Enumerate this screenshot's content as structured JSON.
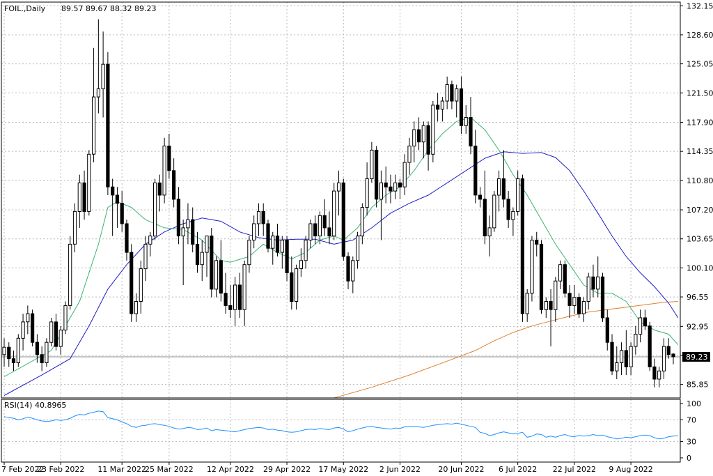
{
  "header": {
    "symbol_label": "FOIL.,Daily",
    "ohlc_label": "89.57 89.67 88.32 89.23"
  },
  "price_badge": "89.23",
  "indicator": {
    "label": "RSI(14) 40.8965",
    "levels": [
      "100",
      "70",
      "30",
      "0"
    ]
  },
  "colors": {
    "bull_candle": "#ffffff",
    "bear_candle": "#000000",
    "ma_fast": "#3cb371",
    "ma_mid": "#1e1ec8",
    "ma_slow": "#e08030",
    "rsi_line": "#1e90ff",
    "badge_bg": "#000000",
    "badge_text": "#ffffff"
  },
  "chart_data": {
    "type": "candlestick",
    "y_ticks": [
      "132.15",
      "128.60",
      "125.05",
      "121.50",
      "117.90",
      "114.35",
      "110.80",
      "107.20",
      "103.65",
      "100.10",
      "96.55",
      "92.95",
      "89.40",
      "85.85"
    ],
    "ylim": [
      84.2,
      132.6
    ],
    "x_ticks": [
      "7 Feb 2022",
      "23 Feb 2022",
      "11 Mar 2022",
      "25 Mar 2022",
      "12 Apr 2022",
      "29 Apr 2022",
      "17 May 2022",
      "2 Jun 2022",
      "20 Jun 2022",
      "6 Jul 2022",
      "22 Jul 2022",
      "9 Aug 2022"
    ],
    "candles": [
      [
        89.5,
        91.5,
        88.0,
        90.4
      ],
      [
        90.4,
        91.0,
        88.0,
        89.0
      ],
      [
        89.0,
        90.0,
        87.5,
        88.5
      ],
      [
        88.5,
        92.0,
        88.0,
        91.5
      ],
      [
        91.5,
        94.5,
        90.0,
        93.5
      ],
      [
        93.5,
        95.5,
        92.0,
        94.5
      ],
      [
        94.5,
        95.0,
        90.5,
        91.0
      ],
      [
        91.0,
        92.0,
        88.5,
        89.5
      ],
      [
        89.5,
        90.5,
        87.5,
        88.5
      ],
      [
        88.5,
        91.5,
        88.0,
        91.0
      ],
      [
        91.0,
        94.0,
        90.5,
        93.5
      ],
      [
        93.5,
        94.5,
        90.0,
        90.5
      ],
      [
        90.5,
        93.0,
        89.5,
        92.5
      ],
      [
        92.5,
        96.0,
        92.0,
        95.5
      ],
      [
        95.5,
        104.0,
        95.0,
        103.0
      ],
      [
        103.0,
        108.0,
        102.0,
        107.0
      ],
      [
        107.0,
        111.5,
        105.0,
        110.5
      ],
      [
        110.5,
        112.0,
        106.0,
        107.0
      ],
      [
        107.0,
        114.5,
        106.5,
        114.0
      ],
      [
        114.0,
        127.0,
        113.0,
        121.0
      ],
      [
        121.0,
        130.5,
        119.0,
        122.0
      ],
      [
        122.0,
        129.0,
        118.5,
        125.0
      ],
      [
        125.0,
        126.5,
        109.0,
        110.0
      ],
      [
        110.0,
        111.0,
        104.0,
        109.0
      ],
      [
        109.0,
        110.0,
        105.0,
        108.0
      ],
      [
        108.0,
        109.5,
        104.5,
        105.5
      ],
      [
        105.5,
        106.0,
        101.0,
        102.0
      ],
      [
        102.0,
        103.0,
        93.5,
        94.5
      ],
      [
        94.5,
        97.0,
        93.5,
        96.0
      ],
      [
        96.0,
        101.0,
        94.5,
        100.0
      ],
      [
        100.0,
        104.0,
        98.5,
        103.0
      ],
      [
        103.0,
        104.5,
        101.5,
        104.0
      ],
      [
        104.0,
        111.0,
        103.5,
        110.5
      ],
      [
        110.5,
        111.5,
        107.0,
        109.0
      ],
      [
        109.0,
        116.0,
        108.0,
        115.0
      ],
      [
        115.0,
        116.5,
        111.0,
        112.0
      ],
      [
        112.0,
        113.5,
        107.5,
        108.5
      ],
      [
        108.5,
        110.0,
        103.0,
        104.0
      ],
      [
        104.0,
        106.0,
        98.0,
        105.0
      ],
      [
        105.0,
        108.0,
        103.0,
        106.0
      ],
      [
        106.0,
        107.5,
        102.0,
        103.0
      ],
      [
        103.0,
        104.5,
        99.5,
        100.5
      ],
      [
        100.5,
        103.5,
        98.5,
        102.0
      ],
      [
        102.0,
        104.0,
        99.0,
        104.0
      ],
      [
        104.0,
        105.0,
        96.5,
        97.5
      ],
      [
        97.5,
        101.5,
        96.5,
        101.0
      ],
      [
        101.0,
        103.5,
        96.0,
        97.0
      ],
      [
        97.0,
        99.5,
        94.5,
        95.5
      ],
      [
        95.5,
        98.0,
        94.0,
        95.0
      ],
      [
        95.0,
        99.0,
        93.0,
        98.0
      ],
      [
        98.0,
        99.5,
        94.0,
        95.0
      ],
      [
        95.0,
        101.0,
        93.0,
        100.5
      ],
      [
        100.5,
        104.0,
        99.5,
        103.5
      ],
      [
        103.5,
        106.5,
        102.5,
        105.5
      ],
      [
        105.5,
        108.0,
        104.0,
        107.0
      ],
      [
        107.0,
        108.0,
        104.0,
        105.5
      ],
      [
        105.5,
        106.0,
        102.0,
        102.5
      ],
      [
        102.5,
        104.5,
        100.5,
        104.0
      ],
      [
        104.0,
        105.5,
        101.5,
        102.0
      ],
      [
        102.0,
        104.0,
        100.0,
        103.5
      ],
      [
        103.5,
        104.0,
        98.5,
        99.5
      ],
      [
        99.5,
        101.5,
        95.0,
        96.0
      ],
      [
        96.0,
        100.5,
        95.0,
        100.0
      ],
      [
        100.0,
        102.5,
        99.0,
        101.0
      ],
      [
        101.0,
        104.0,
        100.0,
        103.5
      ],
      [
        103.5,
        106.0,
        102.5,
        105.5
      ],
      [
        105.5,
        106.5,
        103.0,
        104.0
      ],
      [
        104.0,
        107.0,
        103.0,
        106.5
      ],
      [
        106.5,
        108.5,
        104.0,
        105.0
      ],
      [
        105.0,
        107.0,
        103.0,
        104.0
      ],
      [
        104.0,
        110.5,
        103.5,
        109.5
      ],
      [
        109.5,
        112.0,
        106.5,
        110.5
      ],
      [
        110.5,
        111.0,
        101.0,
        101.5
      ],
      [
        101.5,
        102.0,
        97.5,
        98.5
      ],
      [
        98.5,
        101.5,
        97.0,
        101.0
      ],
      [
        101.0,
        104.5,
        100.0,
        104.0
      ],
      [
        104.0,
        108.0,
        103.0,
        107.5
      ],
      [
        107.5,
        113.0,
        106.5,
        111.0
      ],
      [
        111.0,
        115.5,
        110.5,
        114.5
      ],
      [
        114.5,
        115.0,
        107.5,
        108.5
      ],
      [
        108.5,
        112.0,
        103.5,
        110.5
      ],
      [
        110.5,
        112.5,
        108.0,
        110.0
      ],
      [
        110.0,
        111.5,
        108.0,
        109.5
      ],
      [
        109.5,
        111.5,
        108.5,
        110.5
      ],
      [
        110.5,
        111.0,
        108.5,
        110.0
      ],
      [
        110.0,
        114.0,
        109.0,
        113.0
      ],
      [
        113.0,
        116.0,
        111.5,
        115.0
      ],
      [
        115.0,
        118.0,
        113.0,
        117.0
      ],
      [
        117.0,
        118.5,
        114.5,
        115.5
      ],
      [
        115.5,
        118.0,
        113.5,
        117.5
      ],
      [
        117.5,
        118.0,
        112.0,
        114.0
      ],
      [
        114.0,
        120.5,
        113.0,
        120.0
      ],
      [
        120.0,
        121.5,
        118.0,
        119.5
      ],
      [
        119.5,
        121.0,
        118.0,
        120.5
      ],
      [
        120.5,
        123.5,
        119.5,
        122.5
      ],
      [
        122.5,
        123.0,
        119.5,
        120.5
      ],
      [
        120.5,
        122.5,
        118.5,
        122.0
      ],
      [
        122.0,
        123.5,
        116.5,
        117.5
      ],
      [
        117.5,
        120.0,
        116.5,
        118.5
      ],
      [
        118.5,
        121.0,
        114.0,
        115.0
      ],
      [
        115.0,
        117.0,
        108.0,
        109.0
      ],
      [
        109.0,
        110.0,
        107.5,
        108.5
      ],
      [
        108.5,
        112.0,
        103.0,
        104.0
      ],
      [
        104.0,
        106.5,
        101.5,
        105.0
      ],
      [
        105.0,
        109.5,
        104.5,
        109.0
      ],
      [
        109.0,
        112.0,
        107.0,
        111.0
      ],
      [
        111.0,
        114.5,
        107.5,
        108.5
      ],
      [
        108.5,
        109.5,
        105.0,
        106.0
      ],
      [
        106.0,
        107.5,
        104.0,
        107.0
      ],
      [
        107.0,
        112.0,
        106.5,
        111.0
      ],
      [
        111.0,
        111.5,
        93.5,
        94.5
      ],
      [
        94.5,
        97.5,
        93.5,
        97.0
      ],
      [
        97.0,
        104.0,
        96.0,
        103.5
      ],
      [
        103.5,
        104.5,
        101.5,
        103.0
      ],
      [
        103.0,
        103.5,
        94.5,
        95.0
      ],
      [
        95.0,
        96.5,
        94.0,
        96.0
      ],
      [
        96.0,
        97.5,
        90.5,
        95.0
      ],
      [
        95.0,
        99.0,
        93.5,
        98.5
      ],
      [
        98.5,
        101.0,
        97.5,
        100.5
      ],
      [
        100.5,
        101.0,
        96.5,
        97.0
      ],
      [
        97.0,
        98.0,
        94.0,
        95.5
      ],
      [
        95.5,
        98.0,
        94.5,
        96.5
      ],
      [
        96.5,
        97.0,
        94.0,
        94.5
      ],
      [
        94.5,
        96.5,
        93.5,
        96.0
      ],
      [
        96.0,
        99.5,
        95.0,
        99.0
      ],
      [
        99.0,
        100.5,
        96.5,
        97.5
      ],
      [
        97.5,
        101.5,
        96.5,
        99.0
      ],
      [
        99.0,
        99.5,
        93.5,
        94.0
      ],
      [
        94.0,
        95.0,
        90.0,
        91.0
      ],
      [
        91.0,
        92.0,
        87.0,
        87.5
      ],
      [
        87.5,
        90.5,
        86.5,
        88.5
      ],
      [
        88.5,
        91.0,
        87.0,
        90.0
      ],
      [
        90.0,
        92.5,
        87.0,
        88.0
      ],
      [
        88.0,
        91.0,
        87.0,
        90.5
      ],
      [
        90.5,
        93.0,
        89.5,
        92.0
      ],
      [
        92.0,
        95.0,
        91.0,
        94.0
      ],
      [
        94.0,
        95.0,
        92.5,
        93.0
      ],
      [
        93.0,
        93.5,
        87.5,
        88.0
      ],
      [
        88.0,
        89.0,
        85.5,
        86.5
      ],
      [
        86.5,
        88.0,
        85.5,
        87.5
      ],
      [
        87.5,
        91.5,
        86.5,
        90.5
      ],
      [
        90.5,
        91.5,
        89.0,
        89.5
      ],
      [
        89.57,
        89.67,
        88.32,
        89.23
      ]
    ],
    "rsi": [
      76,
      74,
      73,
      70,
      72,
      75,
      73,
      70,
      68,
      67,
      68,
      70,
      69,
      70,
      73,
      77,
      80,
      79,
      82,
      84,
      86,
      85,
      74,
      72,
      70,
      66,
      63,
      58,
      56,
      59,
      60,
      62,
      63,
      61,
      60,
      58,
      55,
      53,
      54,
      56,
      55,
      52,
      53,
      55,
      50,
      52,
      51,
      50,
      49,
      48,
      50,
      52,
      54,
      55,
      56,
      55,
      52,
      53,
      51,
      50,
      48,
      47,
      48,
      50,
      52,
      53,
      52,
      54,
      53,
      52,
      55,
      56,
      53,
      48,
      50,
      53,
      55,
      57,
      58,
      56,
      55,
      54,
      53,
      55,
      54,
      57,
      58,
      58,
      57,
      56,
      58,
      60,
      61,
      62,
      63,
      62,
      64,
      62,
      60,
      58,
      56,
      47,
      45,
      41,
      43,
      46,
      48,
      46,
      44,
      45,
      47,
      38,
      40,
      44,
      43,
      38,
      40,
      38,
      41,
      43,
      40,
      39,
      41,
      40,
      41,
      43,
      41,
      42,
      39,
      37,
      35,
      36,
      38,
      37,
      39,
      41,
      42,
      41,
      37,
      35,
      36,
      39,
      40,
      40.9
    ],
    "ma_fast": [
      [
        0,
        86.8
      ],
      [
        10,
        90.0
      ],
      [
        16,
        96.0
      ],
      [
        20,
        103.0
      ],
      [
        22,
        107.5
      ],
      [
        24,
        108.2
      ],
      [
        27,
        107.5
      ],
      [
        30,
        106.0
      ],
      [
        34,
        105.0
      ],
      [
        38,
        104.8
      ],
      [
        42,
        103.5
      ],
      [
        46,
        101.0
      ],
      [
        48,
        100.8
      ],
      [
        52,
        101.5
      ],
      [
        55,
        103.0
      ],
      [
        58,
        102.0
      ],
      [
        61,
        101.2
      ],
      [
        64,
        102.0
      ],
      [
        67,
        103.5
      ],
      [
        70,
        104.0
      ],
      [
        72,
        103.5
      ],
      [
        75,
        105.0
      ],
      [
        78,
        107.5
      ],
      [
        81,
        109.0
      ],
      [
        84,
        110.0
      ],
      [
        87,
        112.0
      ],
      [
        90,
        114.5
      ],
      [
        93,
        116.5
      ],
      [
        96,
        118.0
      ],
      [
        99,
        118.5
      ],
      [
        102,
        117.0
      ],
      [
        105,
        114.5
      ],
      [
        108,
        111.5
      ],
      [
        111,
        109.0
      ],
      [
        114,
        106.0
      ],
      [
        117,
        103.0
      ],
      [
        120,
        100.5
      ],
      [
        123,
        98.0
      ],
      [
        126,
        97.0
      ],
      [
        129,
        97.0
      ],
      [
        132,
        96.0
      ],
      [
        135,
        93.5
      ],
      [
        138,
        92.5
      ],
      [
        141,
        92.0
      ],
      [
        143,
        90.7
      ]
    ],
    "ma_mid": [
      [
        0,
        84.5
      ],
      [
        8,
        87.0
      ],
      [
        14,
        89.0
      ],
      [
        18,
        93.0
      ],
      [
        22,
        97.5
      ],
      [
        26,
        100.5
      ],
      [
        30,
        103.0
      ],
      [
        34,
        104.5
      ],
      [
        38,
        105.5
      ],
      [
        42,
        106.2
      ],
      [
        46,
        105.8
      ],
      [
        50,
        104.5
      ],
      [
        54,
        103.8
      ],
      [
        58,
        103.5
      ],
      [
        62,
        103.6
      ],
      [
        66,
        103.6
      ],
      [
        70,
        103.0
      ],
      [
        74,
        103.5
      ],
      [
        78,
        105.0
      ],
      [
        82,
        106.8
      ],
      [
        86,
        108.0
      ],
      [
        90,
        109.0
      ],
      [
        94,
        110.5
      ],
      [
        98,
        112.0
      ],
      [
        102,
        113.5
      ],
      [
        106,
        114.3
      ],
      [
        110,
        114.1
      ],
      [
        114,
        114.2
      ],
      [
        117,
        113.6
      ],
      [
        120,
        112.0
      ],
      [
        123,
        109.5
      ],
      [
        126,
        106.8
      ],
      [
        129,
        104.0
      ],
      [
        132,
        101.5
      ],
      [
        135,
        99.5
      ],
      [
        138,
        97.8
      ],
      [
        141,
        95.8
      ],
      [
        143,
        94.0
      ]
    ],
    "ma_slow": [
      [
        70,
        84.2
      ],
      [
        78,
        85.5
      ],
      [
        86,
        87.0
      ],
      [
        94,
        88.7
      ],
      [
        100,
        90.0
      ],
      [
        104,
        91.2
      ],
      [
        108,
        92.2
      ],
      [
        112,
        93.0
      ],
      [
        116,
        93.6
      ],
      [
        120,
        94.2
      ],
      [
        124,
        94.7
      ],
      [
        128,
        95.0
      ],
      [
        132,
        95.3
      ],
      [
        136,
        95.6
      ],
      [
        140,
        95.9
      ],
      [
        143,
        96.0
      ]
    ]
  }
}
